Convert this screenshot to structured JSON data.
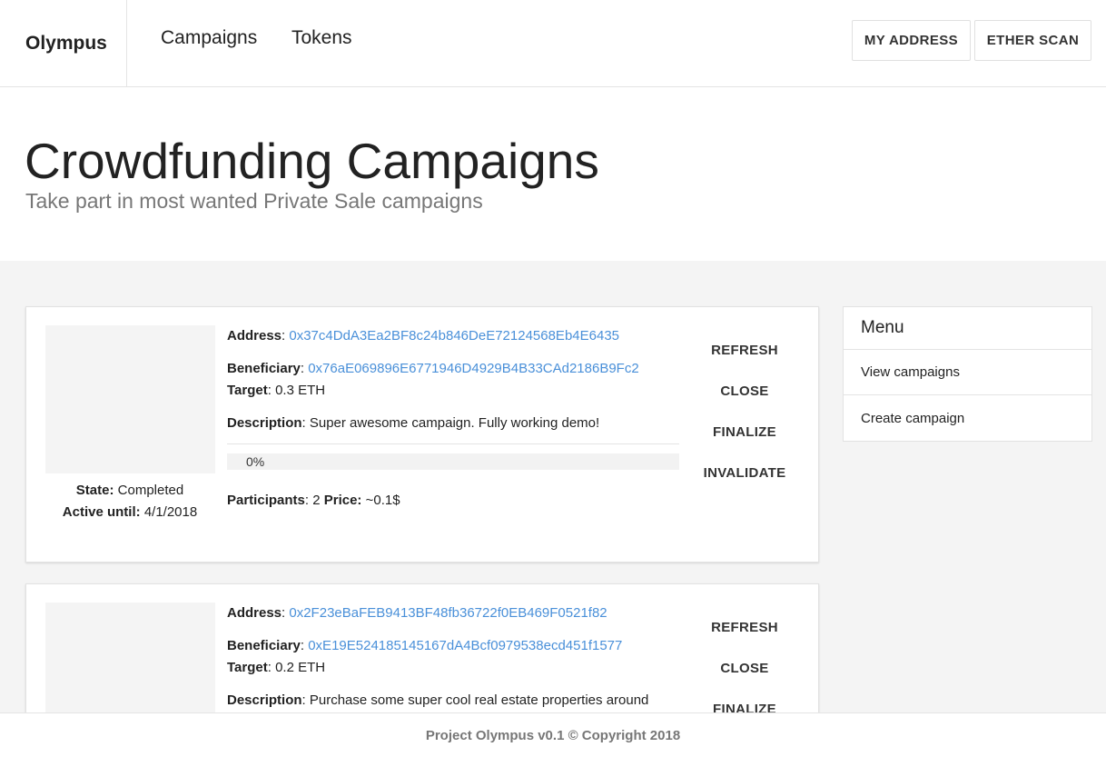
{
  "nav": {
    "brand": "Olympus",
    "links": [
      "Campaigns",
      "Tokens"
    ],
    "buttons": [
      "MY ADDRESS",
      "ETHER SCAN"
    ]
  },
  "hero": {
    "title": "Crowdfunding Campaigns",
    "subtitle": "Take part in most wanted Private Sale campaigns"
  },
  "labels": {
    "address": "Address",
    "beneficiary": "Beneficiary",
    "target": "Target",
    "description": "Description",
    "participants": "Participants",
    "price": "Price:",
    "state": "State:",
    "active_until": "Active until:"
  },
  "campaigns": [
    {
      "address": "0x37c4DdA3Ea2BF8c24b846DeE72124568Eb4E6435",
      "beneficiary": "0x76aE069896E6771946D4929B4B33CAd2186B9Fc2",
      "target": "0.3 ETH",
      "description": "Super awesome campaign. Fully working demo!",
      "progress_text": "0%",
      "progress": 0,
      "participants": "2",
      "price": "~0.1$",
      "state": "Completed",
      "active_until": "4/1/2018",
      "actions": [
        "REFRESH",
        "CLOSE",
        "FINALIZE",
        "INVALIDATE"
      ]
    },
    {
      "address": "0x2F23eBaFEB9413BF48fb36722f0EB469F0521f82",
      "beneficiary": "0xE19E524185145167dA4Bcf0979538ecd451f1577",
      "target": "0.2 ETH",
      "description": "Purchase some super cool real estate properties around",
      "actions": [
        "REFRESH",
        "CLOSE",
        "FINALIZE"
      ]
    }
  ],
  "menu": {
    "title": "Menu",
    "items": [
      "View campaigns",
      "Create campaign"
    ]
  },
  "footer": {
    "text": "Project Olympus v0.1 © Copyright 2018"
  },
  "colors": {
    "link": "#4a90d9",
    "page_background": "#f4f4f4"
  }
}
